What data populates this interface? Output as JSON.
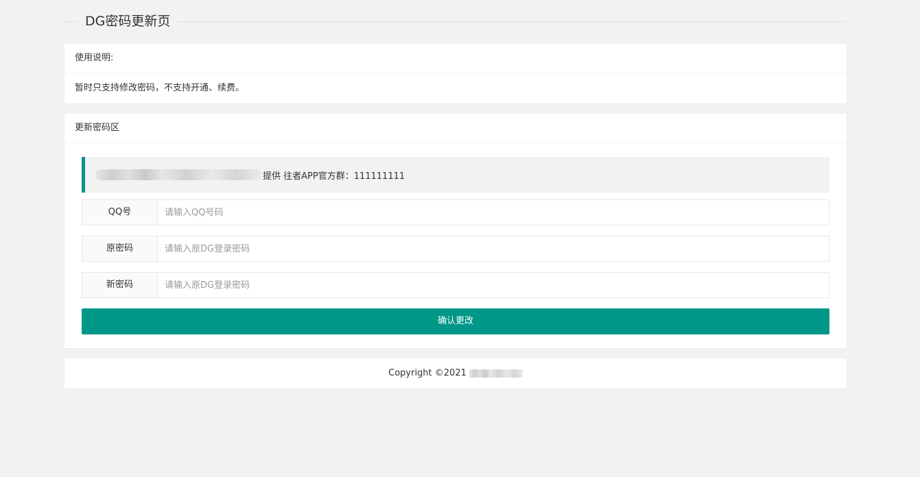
{
  "page": {
    "title": "DG密码更新页"
  },
  "intro": {
    "header": "使用说明:",
    "body": "暂时只支持修改密码，不支持开通、续费。"
  },
  "form_card": {
    "header": "更新密码区",
    "notice_text": "提供 往者APP官方群：111111111",
    "fields": [
      {
        "label": "QQ号",
        "placeholder": "请输入QQ号码",
        "value": ""
      },
      {
        "label": "原密码",
        "placeholder": "请输入原DG登录密码",
        "value": ""
      },
      {
        "label": "新密码",
        "placeholder": "请输入原DG登录密码",
        "value": ""
      }
    ],
    "submit_label": "确认更改"
  },
  "footer": {
    "copyright": "Copyright ©2021"
  },
  "colors": {
    "accent": "#009688",
    "background": "#f2f2f2"
  }
}
